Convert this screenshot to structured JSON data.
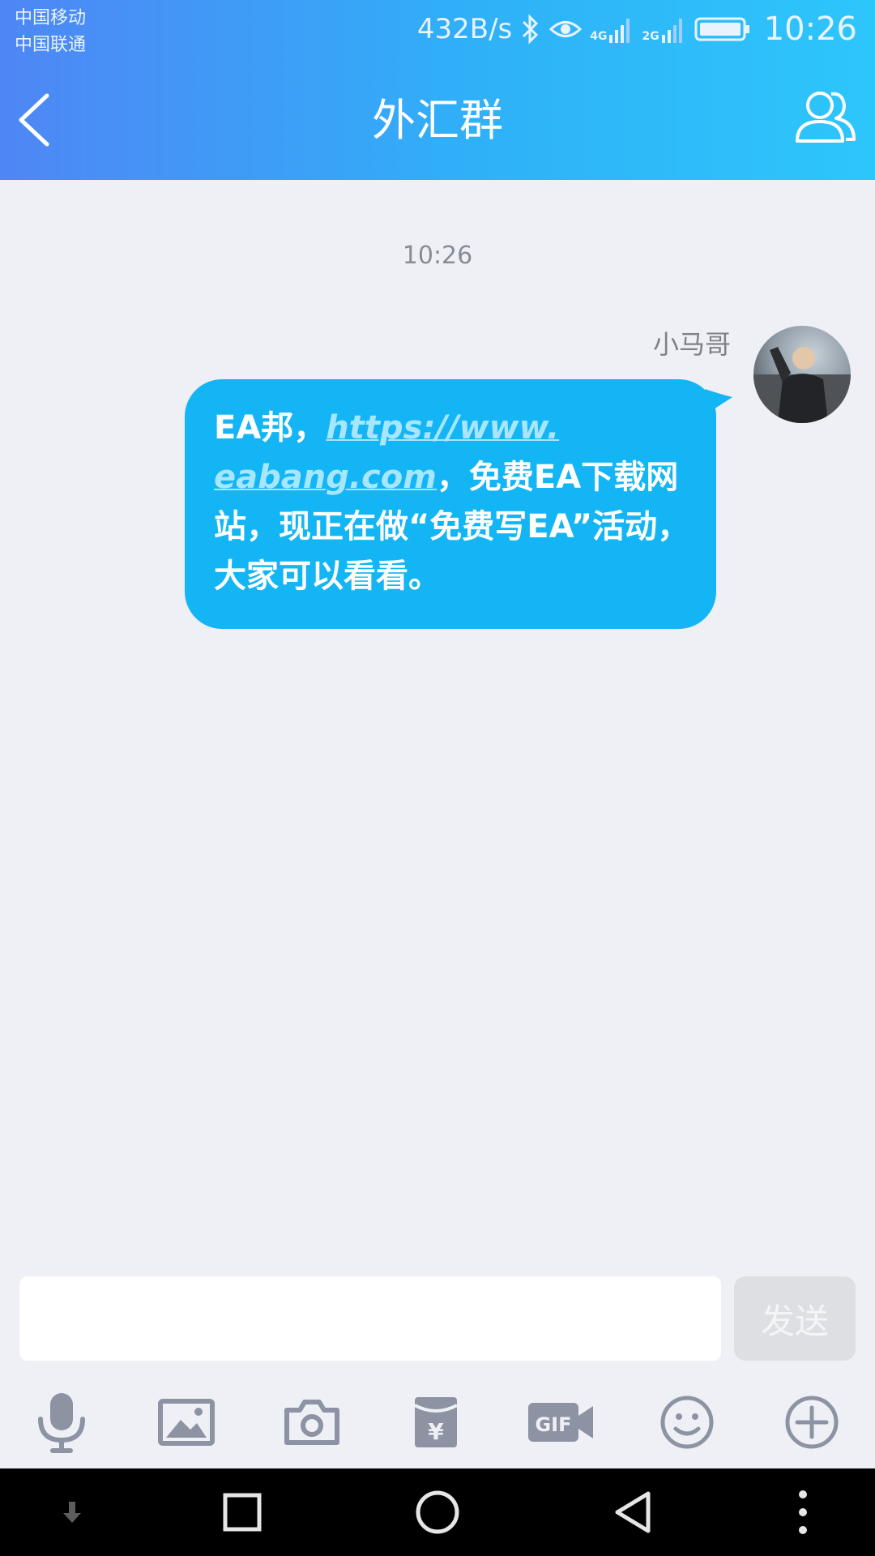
{
  "status_bar": {
    "carrier_1": "中国移动",
    "carrier_2": "中国联通",
    "net_speed": "432B/s",
    "sim1_network": "4G",
    "sim2_network": "2G",
    "time": "10:26",
    "icons": [
      "bluetooth-icon",
      "eye-icon",
      "signal-icon",
      "battery-icon"
    ]
  },
  "header": {
    "title": "外汇群",
    "back_icon": "chevron-left-icon",
    "members_icon": "group-members-icon"
  },
  "chat": {
    "timestamp": "10:26",
    "messages": [
      {
        "sender": "小马哥",
        "text_1": "EA邦，",
        "link": "https://www.eabang.com",
        "link_part1": "https://www.",
        "link_part2": "eabang.com",
        "text_2": "，免费EA下载网站，现正在做“免费写EA”活动，大家可以看看。"
      }
    ]
  },
  "composer": {
    "input_value": "",
    "send_label": "发送"
  },
  "toolbar": {
    "items": [
      "microphone-icon",
      "image-icon",
      "camera-icon",
      "red-packet-icon",
      "gif-icon",
      "emoji-icon",
      "plus-icon"
    ]
  },
  "nav_bar": {
    "items": [
      "download-arrow-icon",
      "recents-square-icon",
      "home-circle-icon",
      "back-triangle-icon",
      "more-dots-icon"
    ]
  },
  "colors": {
    "header_start": "#4f86f5",
    "header_end": "#2dc6fb",
    "bubble": "#13b5f4",
    "background": "#eff0f6"
  }
}
